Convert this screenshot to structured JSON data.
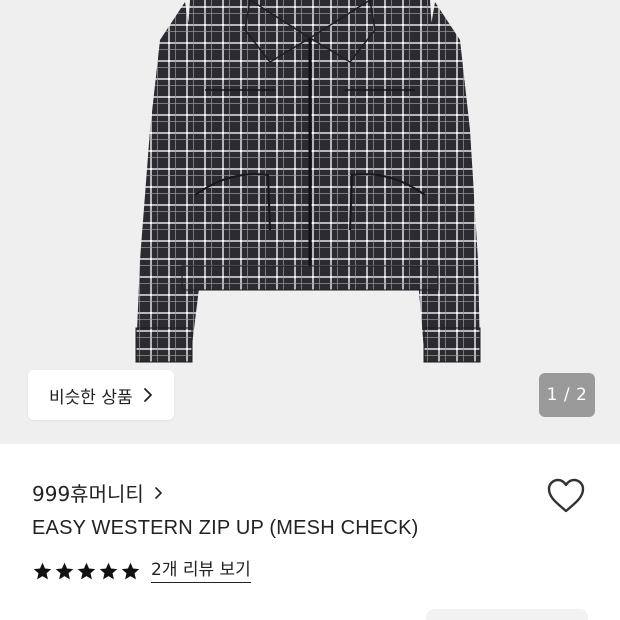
{
  "gallery": {
    "similar_button_label": "비슷한 상품",
    "page_counter": "1 / 2",
    "colors": {
      "background": "#efefef",
      "jacket_dark": "#2a2a2e",
      "jacket_light": "#d8d8dc"
    }
  },
  "product": {
    "brand": "999휴머니티",
    "title": "EASY WESTERN ZIP UP (MESH CHECK)",
    "rating_stars": 5,
    "review_link": "2개 리뷰 보기"
  },
  "icons": {
    "similar_chevron": "chevron-right-icon",
    "brand_chevron": "chevron-right-icon",
    "favorite": "heart-outline-icon",
    "rating": "star-icon"
  }
}
